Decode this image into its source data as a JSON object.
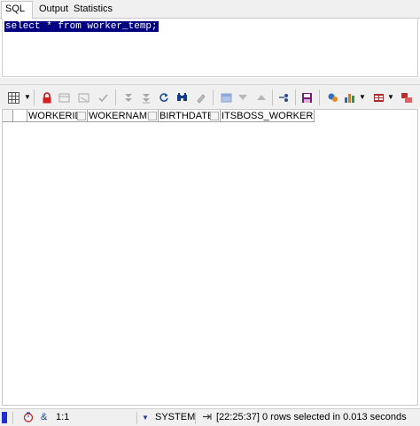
{
  "tabs": [
    {
      "label": "SQL",
      "active": true
    },
    {
      "label": "Output",
      "active": false
    },
    {
      "label": "Statistics",
      "active": false
    }
  ],
  "editor": {
    "sql": "select * from worker_temp;"
  },
  "toolbar": {
    "icons": [
      "grid-options-icon",
      "dropdown-arrow-icon",
      "lock-icon",
      "insert-record-icon",
      "delete-record-icon",
      "post-record-icon",
      "fetch-next-icon",
      "fetch-last-icon",
      "refresh-icon",
      "find-icon",
      "clear-icon",
      "filter-icon",
      "sort-down-icon",
      "sort-up-icon",
      "connect-icon",
      "save-icon",
      "query-by-example-icon",
      "chart-icon",
      "export-icon",
      "import-icon"
    ]
  },
  "grid": {
    "columns": [
      "WORKERID",
      "WOKERNAME",
      "BIRTHDATE",
      "ITSBOSS_WORKERID"
    ],
    "rows": []
  },
  "status": {
    "position": "1:1",
    "schema": "SYSTEM",
    "message": "[22:25:37]  0 rows selected in 0.013 seconds"
  },
  "colors": {
    "selection": "#000080",
    "toolbar_bg": "#f0f0f0"
  }
}
